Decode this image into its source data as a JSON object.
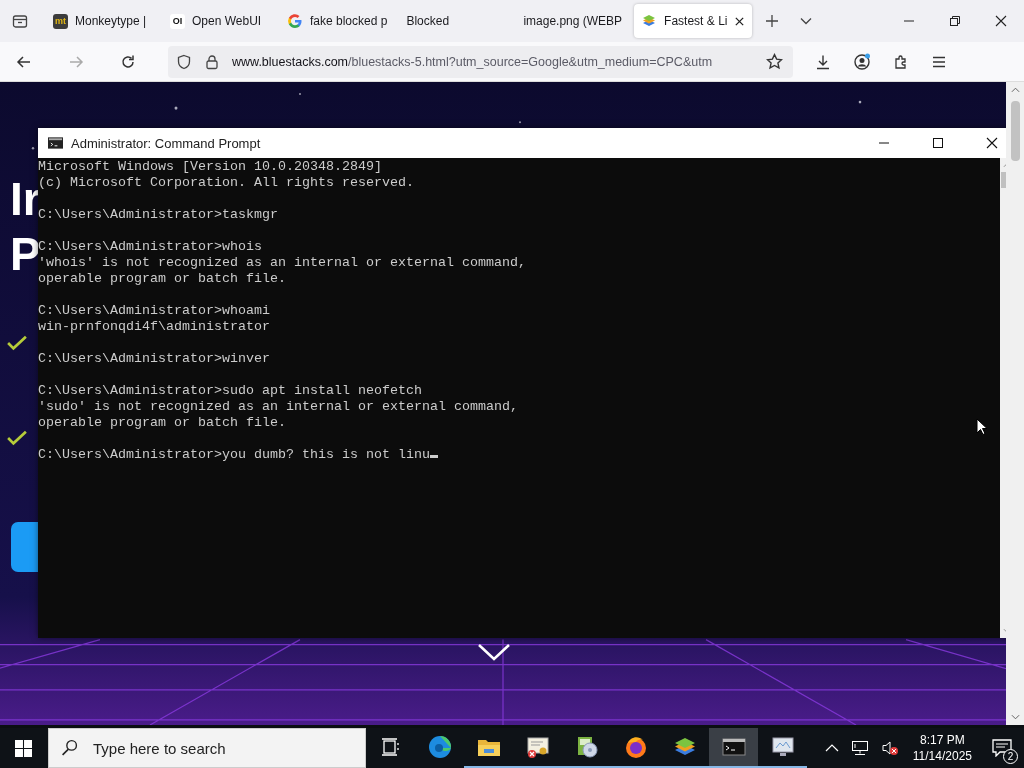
{
  "browser": {
    "tabs": [
      {
        "label": "Monkeytype |",
        "kind": "letters",
        "icon_text": "mt",
        "selected": false
      },
      {
        "label": "Open WebUI",
        "kind": "letters",
        "icon_text": "OI",
        "selected": false
      },
      {
        "label": "fake blocked p",
        "kind": "google",
        "selected": false
      },
      {
        "label": "Blocked",
        "kind": "plain",
        "selected": false
      },
      {
        "label": "image.png (WEBP",
        "kind": "plain",
        "selected": false
      },
      {
        "label": "Fastest & Li",
        "kind": "layers",
        "selected": true
      }
    ],
    "address": {
      "host": "www.bluestacks.com",
      "path": "/bluestacks-5.html?utm_source=Google&utm_medium=CPC&utm"
    }
  },
  "page": {
    "heading_lines": [
      "Ir",
      "P"
    ]
  },
  "console": {
    "title": "Administrator: Command Prompt",
    "blocks": [
      {
        "lines": [
          "Microsoft Windows [Version 10.0.20348.2849]",
          "(c) Microsoft Corporation. All rights reserved."
        ]
      },
      {
        "lines": [
          "C:\\Users\\Administrator>taskmgr"
        ]
      },
      {
        "lines": [
          "C:\\Users\\Administrator>whois",
          "'whois' is not recognized as an internal or external command,",
          "operable program or batch file."
        ]
      },
      {
        "lines": [
          "C:\\Users\\Administrator>whoami",
          "win-prnfonqdi4f\\administrator"
        ]
      },
      {
        "lines": [
          "C:\\Users\\Administrator>winver"
        ]
      },
      {
        "lines": [
          "C:\\Users\\Administrator>sudo apt install neofetch",
          "'sudo' is not recognized as an internal or external command,",
          "operable program or batch file."
        ]
      }
    ],
    "prompt": "C:\\Users\\Administrator>you dumb? this is not linu"
  },
  "taskbar": {
    "search": {
      "placeholder": "Type here to search"
    },
    "apps": [
      {
        "kind": "task-view",
        "running": false,
        "selected": false
      },
      {
        "kind": "edge",
        "running": false,
        "selected": false
      },
      {
        "kind": "folder",
        "running": true,
        "selected": false
      },
      {
        "kind": "certificate",
        "running": true,
        "selected": false
      },
      {
        "kind": "disc",
        "running": true,
        "selected": false
      },
      {
        "kind": "firefox",
        "running": true,
        "selected": false
      },
      {
        "kind": "layers",
        "running": true,
        "selected": false
      },
      {
        "kind": "console",
        "running": true,
        "selected": true
      },
      {
        "kind": "monitor",
        "running": true,
        "selected": false
      }
    ],
    "time": "8:17 PM",
    "date": "11/14/2025",
    "notifications": "2"
  }
}
